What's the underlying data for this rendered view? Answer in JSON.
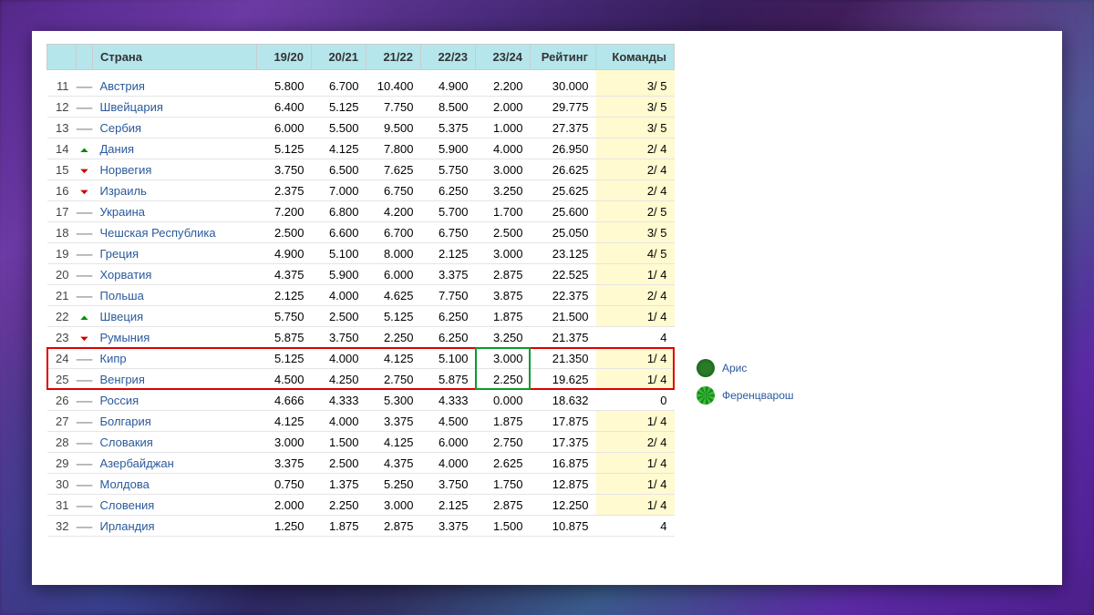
{
  "headers": {
    "rank": "",
    "trend": "",
    "country": "Страна",
    "s1": "19/20",
    "s2": "20/21",
    "s3": "21/22",
    "s4": "22/23",
    "s5": "23/24",
    "rating": "Рейтинг",
    "teams": "Команды"
  },
  "rows": [
    {
      "rank": 11,
      "trend": "same",
      "country": "Австрия",
      "v": [
        "5.800",
        "6.700",
        "10.400",
        "4.900",
        "2.200"
      ],
      "rating": "30.000",
      "teams": "3/ 5",
      "hl": true
    },
    {
      "rank": 12,
      "trend": "same",
      "country": "Швейцария",
      "v": [
        "6.400",
        "5.125",
        "7.750",
        "8.500",
        "2.000"
      ],
      "rating": "29.775",
      "teams": "3/ 5",
      "hl": true
    },
    {
      "rank": 13,
      "trend": "same",
      "country": "Сербия",
      "v": [
        "6.000",
        "5.500",
        "9.500",
        "5.375",
        "1.000"
      ],
      "rating": "27.375",
      "teams": "3/ 5",
      "hl": true
    },
    {
      "rank": 14,
      "trend": "up",
      "country": "Дания",
      "v": [
        "5.125",
        "4.125",
        "7.800",
        "5.900",
        "4.000"
      ],
      "rating": "26.950",
      "teams": "2/ 4",
      "hl": true
    },
    {
      "rank": 15,
      "trend": "down",
      "country": "Норвегия",
      "v": [
        "3.750",
        "6.500",
        "7.625",
        "5.750",
        "3.000"
      ],
      "rating": "26.625",
      "teams": "2/ 4",
      "hl": true
    },
    {
      "rank": 16,
      "trend": "down",
      "country": "Израиль",
      "v": [
        "2.375",
        "7.000",
        "6.750",
        "6.250",
        "3.250"
      ],
      "rating": "25.625",
      "teams": "2/ 4",
      "hl": true
    },
    {
      "rank": 17,
      "trend": "same",
      "country": "Украина",
      "v": [
        "7.200",
        "6.800",
        "4.200",
        "5.700",
        "1.700"
      ],
      "rating": "25.600",
      "teams": "2/ 5",
      "hl": true
    },
    {
      "rank": 18,
      "trend": "same",
      "country": "Чешская Республика",
      "v": [
        "2.500",
        "6.600",
        "6.700",
        "6.750",
        "2.500"
      ],
      "rating": "25.050",
      "teams": "3/ 5",
      "hl": true
    },
    {
      "rank": 19,
      "trend": "same",
      "country": "Греция",
      "v": [
        "4.900",
        "5.100",
        "8.000",
        "2.125",
        "3.000"
      ],
      "rating": "23.125",
      "teams": "4/ 5",
      "hl": true
    },
    {
      "rank": 20,
      "trend": "same",
      "country": "Хорватия",
      "v": [
        "4.375",
        "5.900",
        "6.000",
        "3.375",
        "2.875"
      ],
      "rating": "22.525",
      "teams": "1/ 4",
      "hl": true
    },
    {
      "rank": 21,
      "trend": "same",
      "country": "Польша",
      "v": [
        "2.125",
        "4.000",
        "4.625",
        "7.750",
        "3.875"
      ],
      "rating": "22.375",
      "teams": "2/ 4",
      "hl": true
    },
    {
      "rank": 22,
      "trend": "up",
      "country": "Швеция",
      "v": [
        "5.750",
        "2.500",
        "5.125",
        "6.250",
        "1.875"
      ],
      "rating": "21.500",
      "teams": "1/ 4",
      "hl": true
    },
    {
      "rank": 23,
      "trend": "down",
      "country": "Румыния",
      "v": [
        "5.875",
        "3.750",
        "2.250",
        "6.250",
        "3.250"
      ],
      "rating": "21.375",
      "teams": "4",
      "hl": false
    },
    {
      "rank": 24,
      "trend": "same",
      "country": "Кипр",
      "v": [
        "5.125",
        "4.000",
        "4.125",
        "5.100",
        "3.000"
      ],
      "rating": "21.350",
      "teams": "1/ 4",
      "hl": true,
      "redbox": true,
      "greenbox": true
    },
    {
      "rank": 25,
      "trend": "same",
      "country": "Венгрия",
      "v": [
        "4.500",
        "4.250",
        "2.750",
        "5.875",
        "2.250"
      ],
      "rating": "19.625",
      "teams": "1/ 4",
      "hl": true,
      "redbox": true,
      "greenbox": true
    },
    {
      "rank": 26,
      "trend": "same",
      "country": "Россия",
      "v": [
        "4.666",
        "4.333",
        "5.300",
        "4.333",
        "0.000"
      ],
      "rating": "18.632",
      "teams": "0",
      "hl": false
    },
    {
      "rank": 27,
      "trend": "same",
      "country": "Болгария",
      "v": [
        "4.125",
        "4.000",
        "3.375",
        "4.500",
        "1.875"
      ],
      "rating": "17.875",
      "teams": "1/ 4",
      "hl": true
    },
    {
      "rank": 28,
      "trend": "same",
      "country": "Словакия",
      "v": [
        "3.000",
        "1.500",
        "4.125",
        "6.000",
        "2.750"
      ],
      "rating": "17.375",
      "teams": "2/ 4",
      "hl": true
    },
    {
      "rank": 29,
      "trend": "same",
      "country": "Азербайджан",
      "v": [
        "3.375",
        "2.500",
        "4.375",
        "4.000",
        "2.625"
      ],
      "rating": "16.875",
      "teams": "1/ 4",
      "hl": true
    },
    {
      "rank": 30,
      "trend": "same",
      "country": "Молдова",
      "v": [
        "0.750",
        "1.375",
        "5.250",
        "3.750",
        "1.750"
      ],
      "rating": "12.875",
      "teams": "1/ 4",
      "hl": true
    },
    {
      "rank": 31,
      "trend": "same",
      "country": "Словения",
      "v": [
        "2.000",
        "2.250",
        "3.000",
        "2.125",
        "2.875"
      ],
      "rating": "12.250",
      "teams": "1/ 4",
      "hl": true
    },
    {
      "rank": 32,
      "trend": "same",
      "country": "Ирландия",
      "v": [
        "1.250",
        "1.875",
        "2.875",
        "3.375",
        "1.500"
      ],
      "rating": "10.875",
      "teams": "4",
      "hl": false
    }
  ],
  "side": {
    "team1": "Арис",
    "team2": "Ференцварош"
  }
}
